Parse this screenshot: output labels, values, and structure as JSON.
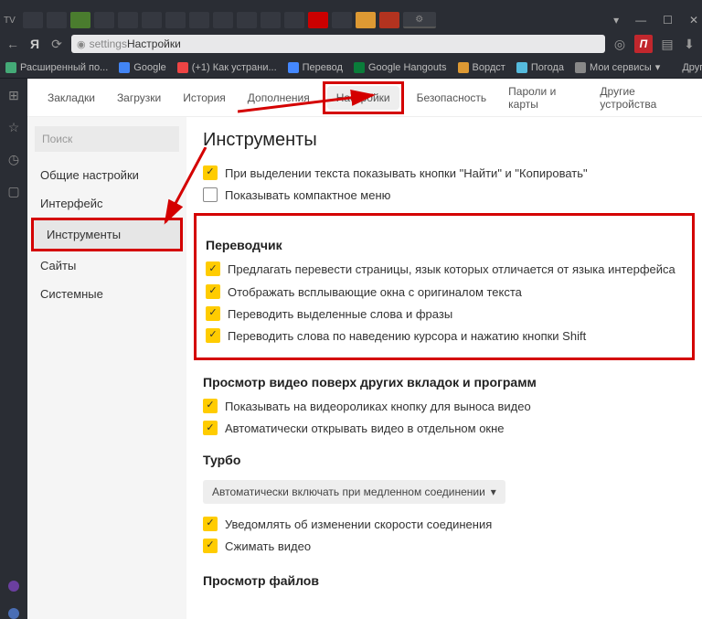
{
  "titlebar": {
    "close": "✕",
    "max": "☐",
    "min": "—",
    "down": "▾"
  },
  "address": {
    "url_prefix": "settings",
    "url_text": " Настройки"
  },
  "bookmarks": {
    "items": [
      "Расширенный по...",
      "Google",
      "(+1) Как устрани...",
      "Перевод",
      "Google Hangouts",
      "Вордст",
      "Погода",
      "Мои сервисы"
    ],
    "other": "Другие закладки"
  },
  "tabs_nav": {
    "items": [
      "Закладки",
      "Загрузки",
      "История",
      "Дополнения",
      "Настройки",
      "Безопасность",
      "Пароли и карты",
      "Другие устройства"
    ],
    "active_index": 4
  },
  "sidebar": {
    "search_placeholder": "Поиск",
    "items": [
      "Общие настройки",
      "Интерфейс",
      "Инструменты",
      "Сайты",
      "Системные"
    ],
    "active_index": 2
  },
  "settings": {
    "title": "Инструменты",
    "top_checks": [
      {
        "checked": true,
        "label": "При выделении текста показывать кнопки \"Найти\" и \"Копировать\""
      },
      {
        "checked": false,
        "label": "Показывать компактное меню"
      }
    ],
    "translator": {
      "heading": "Переводчик",
      "checks": [
        {
          "checked": true,
          "label": "Предлагать перевести страницы, язык которых отличается от языка интерфейса"
        },
        {
          "checked": true,
          "label": "Отображать всплывающие окна с оригиналом текста"
        },
        {
          "checked": true,
          "label": "Переводить выделенные слова и фразы"
        },
        {
          "checked": true,
          "label": "Переводить слова по наведению курсора и нажатию кнопки Shift"
        }
      ]
    },
    "video": {
      "heading": "Просмотр видео поверх других вкладок и программ",
      "checks": [
        {
          "checked": true,
          "label": "Показывать на видеороликах кнопку для выноса видео"
        },
        {
          "checked": true,
          "label": "Автоматически открывать видео в отдельном окне"
        }
      ]
    },
    "turbo": {
      "heading": "Турбо",
      "select": "Автоматически включать при медленном соединении",
      "checks": [
        {
          "checked": true,
          "label": "Уведомлять об изменении скорости соединения"
        },
        {
          "checked": true,
          "label": "Сжимать видео"
        }
      ]
    },
    "files": {
      "heading": "Просмотр файлов"
    }
  }
}
